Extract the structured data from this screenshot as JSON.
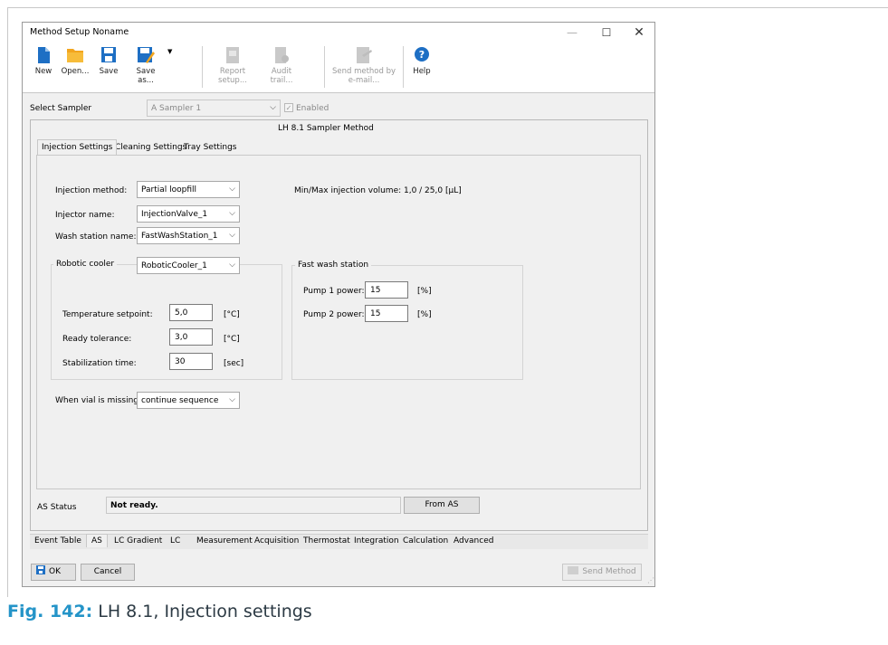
{
  "window": {
    "title": "Method Setup Noname"
  },
  "toolbar": {
    "new": "New",
    "open": "Open...",
    "save": "Save",
    "save_as": "Save as...",
    "report_setup": "Report setup...",
    "audit_trail": "Audit trail...",
    "send_method_line1": "Send method by",
    "send_method_line2": "e-mail...",
    "help": "Help"
  },
  "sampler": {
    "label": "Select Sampler",
    "value": "A Sampler 1",
    "enabled_label": "Enabled"
  },
  "method_title": "LH 8.1 Sampler Method",
  "inner_tabs": [
    "Injection Settings",
    "Cleaning Settings",
    "Tray Settings"
  ],
  "injection": {
    "method_label": "Injection method:",
    "method_value": "Partial loopfill",
    "injector_label": "Injector name:",
    "injector_value": "InjectionValve_1",
    "wash_label": "Wash station name:",
    "wash_value": "FastWashStation_1",
    "volume_text": "Min/Max injection volume: 1,0 / 25,0 [µL]"
  },
  "cooler": {
    "title": "Robotic cooler",
    "value": "RoboticCooler_1",
    "temp_label": "Temperature setpoint:",
    "temp_value": "5,0",
    "temp_unit": "[°C]",
    "tol_label": "Ready tolerance:",
    "tol_value": "3,0",
    "tol_unit": "[°C]",
    "stab_label": "Stabilization time:",
    "stab_value": "30",
    "stab_unit": "[sec]"
  },
  "fastwash": {
    "title": "Fast wash station",
    "pump1_label": "Pump 1 power:",
    "pump1_value": "15",
    "pump1_unit": "[%]",
    "pump2_label": "Pump 2 power:",
    "pump2_value": "15",
    "pump2_unit": "[%]"
  },
  "vial": {
    "label": "When vial is missing:",
    "value": "continue sequence"
  },
  "status": {
    "label": "AS Status",
    "value": "Not ready.",
    "button": "From AS"
  },
  "bottom_tabs": [
    "Event Table",
    "AS",
    "LC Gradient",
    "LC",
    "Measurement",
    "Acquisition",
    "Thermostat",
    "Integration",
    "Calculation",
    "Advanced"
  ],
  "footer": {
    "ok": "OK",
    "cancel": "Cancel",
    "send": "Send Method"
  },
  "caption": {
    "fig": "Fig. 142:",
    "text": "LH 8.1, Injection settings"
  },
  "colors": {
    "accent": "#1e6fc4",
    "caption_blue": "#2494c8"
  }
}
